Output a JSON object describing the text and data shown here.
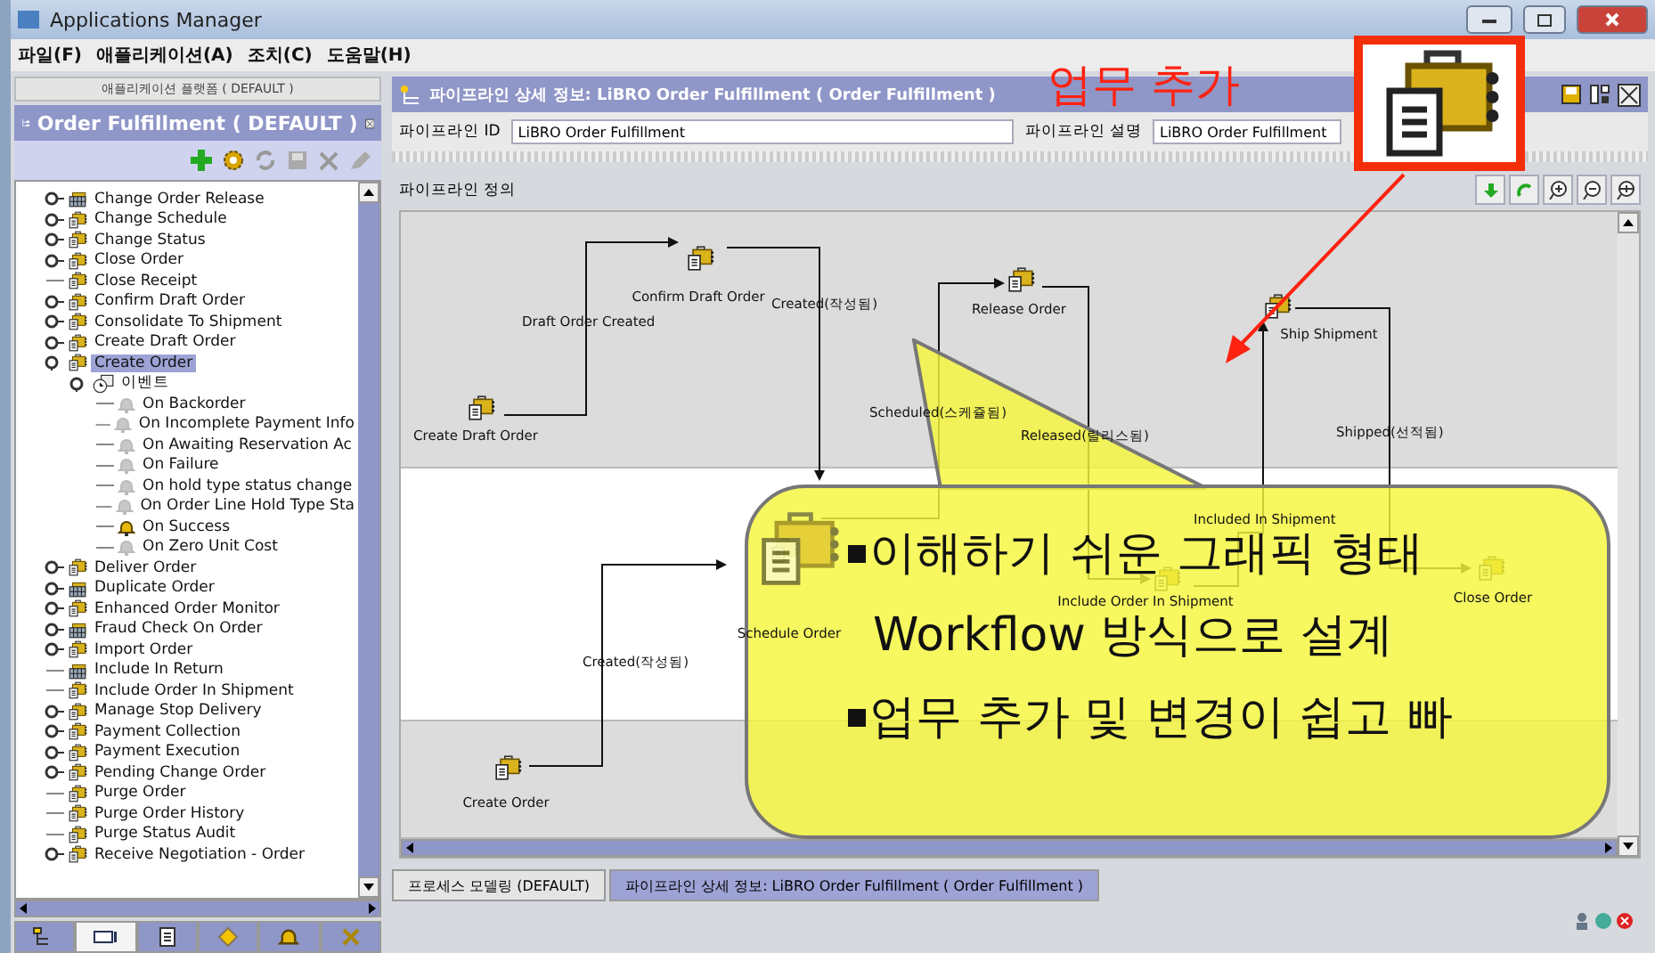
{
  "window": {
    "title": "Applications Manager"
  },
  "menu": [
    "파일(F)",
    "애플리케이션(A)",
    "조치(C)",
    "도움말(H)"
  ],
  "left_panel": {
    "subtitle": "애플리케이션 플랫폼 ( DEFAULT )",
    "title": "Order Fulfillment ( DEFAULT )",
    "tree": [
      {
        "label": "Change Order Release",
        "kind": "service",
        "expanded": false,
        "selected": false
      },
      {
        "label": "Change Schedule",
        "kind": "folder",
        "expanded": false,
        "selected": false
      },
      {
        "label": "Change Status",
        "kind": "folder",
        "expanded": false,
        "selected": false
      },
      {
        "label": "Close Order",
        "kind": "folder",
        "expanded": false,
        "selected": false
      },
      {
        "label": "Close Receipt",
        "kind": "folder",
        "selected": false
      },
      {
        "label": "Confirm Draft Order",
        "kind": "folder",
        "expanded": false,
        "selected": false
      },
      {
        "label": "Consolidate To Shipment",
        "kind": "folder",
        "expanded": false,
        "selected": false
      },
      {
        "label": "Create Draft Order",
        "kind": "folder",
        "expanded": false,
        "selected": false
      },
      {
        "label": "Create Order",
        "kind": "folder",
        "expanded": true,
        "selected": true,
        "children": [
          {
            "label": "이벤트",
            "kind": "events",
            "expanded": true,
            "selected": false,
            "children": [
              {
                "label": "On Backorder",
                "kind": "event",
                "active": false,
                "selected": false
              },
              {
                "label": "On Incomplete Payment Info",
                "kind": "event",
                "active": false,
                "selected": false
              },
              {
                "label": "On Awaiting Reservation Ac",
                "kind": "event",
                "active": false,
                "selected": false
              },
              {
                "label": "On Failure",
                "kind": "event",
                "active": false,
                "selected": false
              },
              {
                "label": "On hold type status change",
                "kind": "event",
                "active": false,
                "selected": false
              },
              {
                "label": "On Order Line Hold Type Sta",
                "kind": "event",
                "active": false,
                "selected": false
              },
              {
                "label": "On Success",
                "kind": "event",
                "active": true,
                "selected": false
              },
              {
                "label": "On Zero Unit Cost",
                "kind": "event",
                "active": false,
                "selected": false
              }
            ]
          }
        ]
      },
      {
        "label": "Deliver Order",
        "kind": "folder",
        "expanded": false,
        "selected": false
      },
      {
        "label": "Duplicate Order",
        "kind": "service",
        "expanded": false,
        "selected": false
      },
      {
        "label": "Enhanced Order Monitor",
        "kind": "folder",
        "expanded": false,
        "selected": false
      },
      {
        "label": "Fraud Check On Order",
        "kind": "service",
        "expanded": false,
        "selected": false
      },
      {
        "label": "Import Order",
        "kind": "folder",
        "expanded": false,
        "selected": false
      },
      {
        "label": "Include In Return",
        "kind": "service",
        "selected": false
      },
      {
        "label": "Include Order In Shipment",
        "kind": "folder",
        "selected": false
      },
      {
        "label": "Manage Stop Delivery",
        "kind": "folder",
        "expanded": false,
        "selected": false
      },
      {
        "label": "Payment Collection",
        "kind": "folder",
        "expanded": false,
        "selected": false
      },
      {
        "label": "Payment Execution",
        "kind": "folder",
        "expanded": false,
        "selected": false
      },
      {
        "label": "Pending Change Order",
        "kind": "folder",
        "expanded": false,
        "selected": false
      },
      {
        "label": "Purge Order",
        "kind": "folder",
        "selected": false
      },
      {
        "label": "Purge Order History",
        "kind": "folder",
        "selected": false
      },
      {
        "label": "Purge Status Audit",
        "kind": "folder",
        "selected": false
      },
      {
        "label": "Receive Negotiation - Order",
        "kind": "folder",
        "expanded": false,
        "selected": false
      }
    ],
    "tabs": [
      {
        "selected": false
      },
      {
        "selected": true
      },
      {
        "selected": false
      },
      {
        "selected": false
      },
      {
        "selected": false
      },
      {
        "selected": false
      }
    ]
  },
  "detail": {
    "title": "파이프라인 상세 정보: LiBRO Order Fulfillment ( Order Fulfillment )",
    "fields": [
      {
        "label": "파이프라인 ID",
        "value": "LiBRO Order Fulfillment"
      },
      {
        "label": "파이프라인 설명",
        "value": "LiBRO Order Fulfillment"
      }
    ],
    "section": "파이프라인 정의",
    "nodes": [
      "Create Draft Order",
      "Confirm Draft Order",
      "Release Order",
      "Ship Shipment",
      "Schedule Order",
      "Include Order In Shipment",
      "Close Order",
      "Create Order"
    ],
    "edges": [
      "Draft Order Created",
      "Created(작성됨)",
      "Scheduled(스케쥴됨)",
      "Released(릴리스됨)",
      "Included In Shipment",
      "Shipped(선적됨)",
      "Created(작성됨)"
    ]
  },
  "bottom_tabs": [
    {
      "label": "프로세스 모델링 (DEFAULT)",
      "selected": false
    },
    {
      "label": "파이프라인 상세 정보: LiBRO Order Fulfillment ( Order Fulfillment )",
      "selected": true
    }
  ],
  "annotation": {
    "label": "업무 추가"
  },
  "callout": {
    "bullets": [
      "이해하기 쉬운 그래픽 형태",
      "Workflow 방식으로 설계",
      "업무 추가 및 변경이 쉽고 빠"
    ]
  }
}
